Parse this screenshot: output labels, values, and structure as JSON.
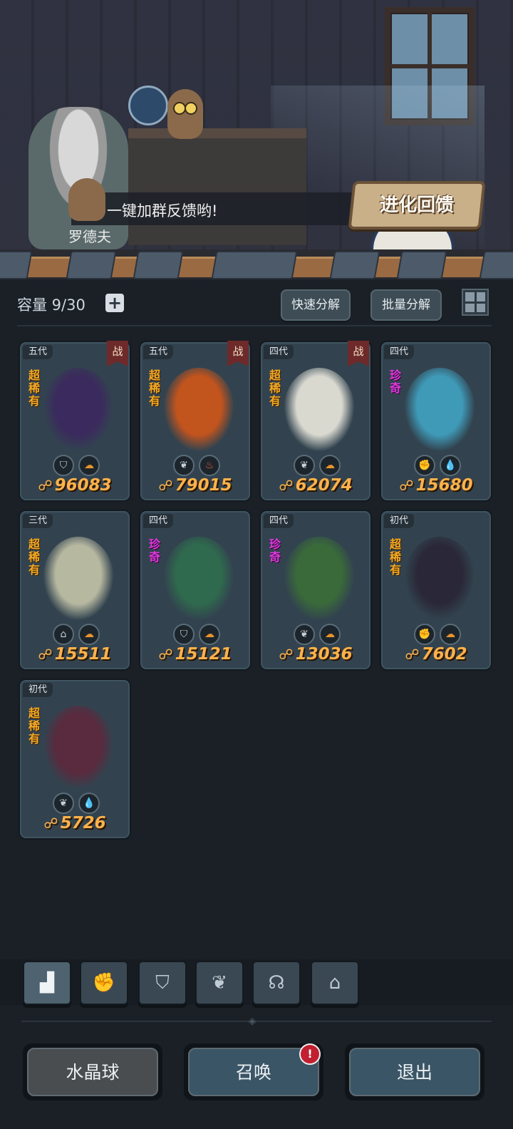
{
  "banner": {
    "dialog_text": "一键加群反馈哟!",
    "speaker_name": "罗德夫",
    "evolution_button": "进化回馈"
  },
  "toolbar": {
    "capacity": "容量 9/30",
    "quick_decompose": "快速分解",
    "batch_decompose": "批量分解"
  },
  "icons": {
    "plus": "+",
    "power": "☍",
    "badge": "!"
  },
  "cards": [
    {
      "generation": "五代",
      "rarity": "超稀有",
      "rarity_type": "super",
      "battle_tag": "战",
      "power": "96083",
      "icons": [
        "shield-icon",
        "earth-icon"
      ],
      "art_color": "#3b2a5e"
    },
    {
      "generation": "五代",
      "rarity": "超稀有",
      "rarity_type": "super",
      "battle_tag": "战",
      "power": "79015",
      "icons": [
        "sprout-icon",
        "fire-icon"
      ],
      "art_color": "#c2541e"
    },
    {
      "generation": "四代",
      "rarity": "超稀有",
      "rarity_type": "super",
      "battle_tag": "战",
      "power": "62074",
      "icons": [
        "sprout-icon",
        "earth-icon"
      ],
      "art_color": "#d9d9d0"
    },
    {
      "generation": "四代",
      "rarity": "珍奇",
      "rarity_type": "rare",
      "battle_tag": "",
      "power": "15680",
      "icons": [
        "fist-icon",
        "water-icon"
      ],
      "art_color": "#3f9ab8"
    },
    {
      "generation": "三代",
      "rarity": "超稀有",
      "rarity_type": "super",
      "battle_tag": "",
      "power": "15511",
      "icons": [
        "tower-icon",
        "earth-icon"
      ],
      "art_color": "#b7b8a0"
    },
    {
      "generation": "四代",
      "rarity": "珍奇",
      "rarity_type": "rare",
      "battle_tag": "",
      "power": "15121",
      "icons": [
        "shield-icon",
        "earth-icon"
      ],
      "art_color": "#2f6a4e"
    },
    {
      "generation": "四代",
      "rarity": "珍奇",
      "rarity_type": "rare",
      "battle_tag": "",
      "power": "13036",
      "icons": [
        "sprout-icon",
        "earth-icon"
      ],
      "art_color": "#3a6a3a"
    },
    {
      "generation": "初代",
      "rarity": "超稀有",
      "rarity_type": "super",
      "battle_tag": "",
      "power": "7602",
      "icons": [
        "fist-icon",
        "earth-icon"
      ],
      "art_color": "#2a2838"
    },
    {
      "generation": "初代",
      "rarity": "超稀有",
      "rarity_type": "super",
      "battle_tag": "",
      "power": "5726",
      "icons": [
        "sprout-icon",
        "water-icon"
      ],
      "art_color": "#5a2a3e"
    }
  ],
  "filter_tabs": [
    "all-icon",
    "fist-icon",
    "shield-icon",
    "sprout-icon",
    "alien-icon",
    "tower-icon"
  ],
  "bottom": {
    "crystal_ball": "水晶球",
    "summon": "召唤",
    "exit": "退出"
  }
}
